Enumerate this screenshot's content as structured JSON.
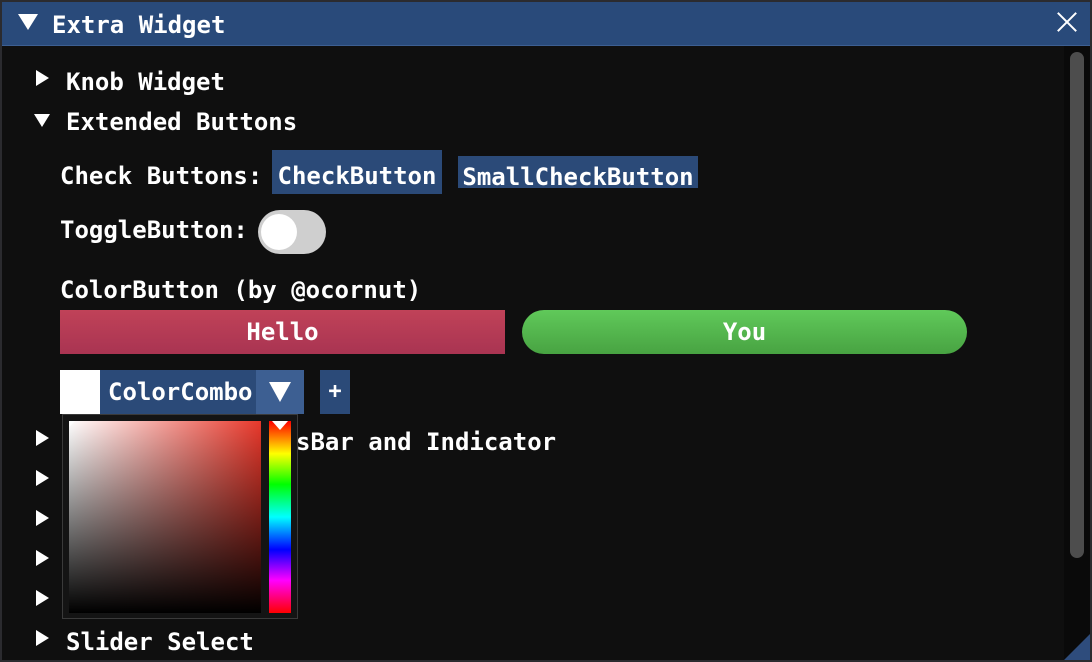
{
  "window": {
    "title": "Extra Widget"
  },
  "tree": {
    "knob_widget": "Knob Widget",
    "extended_buttons": "Extended Buttons",
    "progress_partial": "sBar and Indicator",
    "slider_select": "Slider Select"
  },
  "extended_buttons": {
    "check_label": "Check Buttons:",
    "check_button": "CheckButton",
    "small_check_button": "SmallCheckButton",
    "toggle_label": "ToggleButton:",
    "toggle_state": false,
    "color_button_label": "ColorButton (by @ocornut)",
    "hello_label": "Hello",
    "you_label": "You",
    "combo_label": "ColorCombo",
    "plus_label": "+"
  },
  "colors": {
    "title_bar": "#294a7a",
    "button_blue": "#2b4a78",
    "hello": "#b33a55",
    "you": "#55b64f",
    "selected_swatch": "#ffffff",
    "picker_hue": "#e8382b"
  },
  "icons": {
    "collapse": "triangle-down-icon",
    "expand": "triangle-right-icon",
    "close": "close-icon",
    "combo": "chevron-down-icon"
  }
}
